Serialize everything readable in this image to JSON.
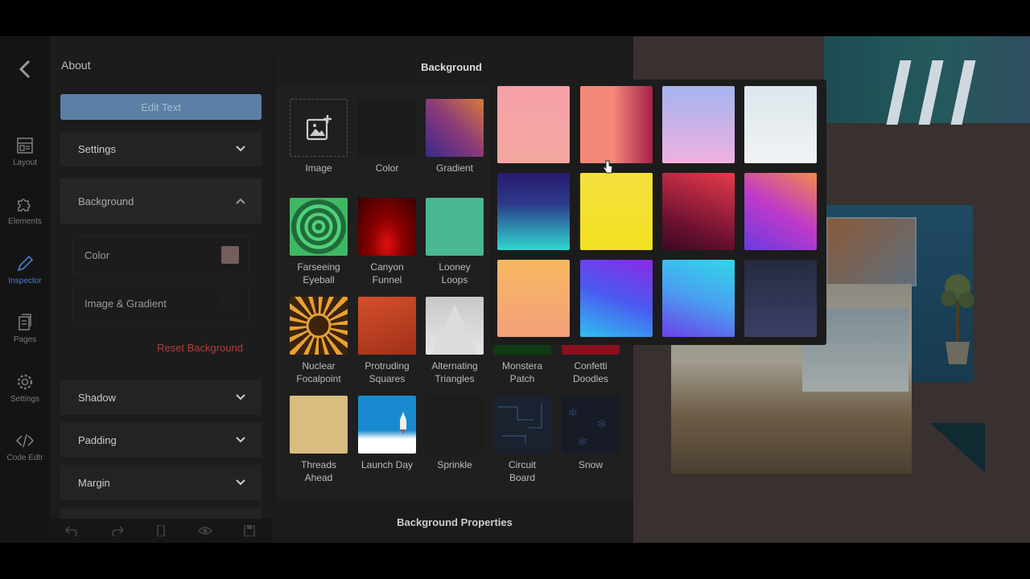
{
  "rail": {
    "back_icon": "chevron-left-icon",
    "items": [
      {
        "label": "Layout",
        "icon": "layout-icon"
      },
      {
        "label": "Elements",
        "icon": "puzzle-icon"
      },
      {
        "label": "Inspector",
        "icon": "pen-icon"
      },
      {
        "label": "Pages",
        "icon": "pages-icon"
      },
      {
        "label": "Settings",
        "icon": "gear-icon"
      },
      {
        "label": "Code Edtr",
        "icon": "code-icon"
      }
    ]
  },
  "panel": {
    "title": "About",
    "edit_text": "Edit Text",
    "sections": {
      "settings": "Settings",
      "background": "Background",
      "shadow": "Shadow",
      "padding": "Padding",
      "margin": "Margin"
    },
    "color_label": "Color",
    "image_gradient_label": "Image & Gradient",
    "reset_label": "Reset Background"
  },
  "drawer": {
    "title": "Background",
    "properties_label": "Background Properties",
    "tiles": [
      {
        "label1": "Image",
        "label2": ""
      },
      {
        "label1": "Color",
        "label2": ""
      },
      {
        "label1": "Gradient",
        "label2": ""
      },
      {
        "label1": "Farseeing",
        "label2": "Eyeball"
      },
      {
        "label1": "Canyon",
        "label2": "Funnel"
      },
      {
        "label1": "Looney",
        "label2": "Loops"
      },
      {
        "label1": "Nuclear",
        "label2": "Focalpoint"
      },
      {
        "label1": "Protruding",
        "label2": "Squares"
      },
      {
        "label1": "Alternating",
        "label2": "Triangles"
      },
      {
        "label1": "Monstera",
        "label2": "Patch"
      },
      {
        "label1": "Confetti",
        "label2": "Doodles"
      },
      {
        "label1": "Threads",
        "label2": "Ahead"
      },
      {
        "label1": "Launch Day",
        "label2": ""
      },
      {
        "label1": "Sprinkle",
        "label2": ""
      },
      {
        "label1": "Circuit",
        "label2": "Board"
      },
      {
        "label1": "Snow",
        "label2": ""
      }
    ]
  },
  "colors": {
    "accent_blue": "#5b7fa5",
    "inspector_active": "#4a7fd0",
    "reset_red": "#b23b3b"
  }
}
